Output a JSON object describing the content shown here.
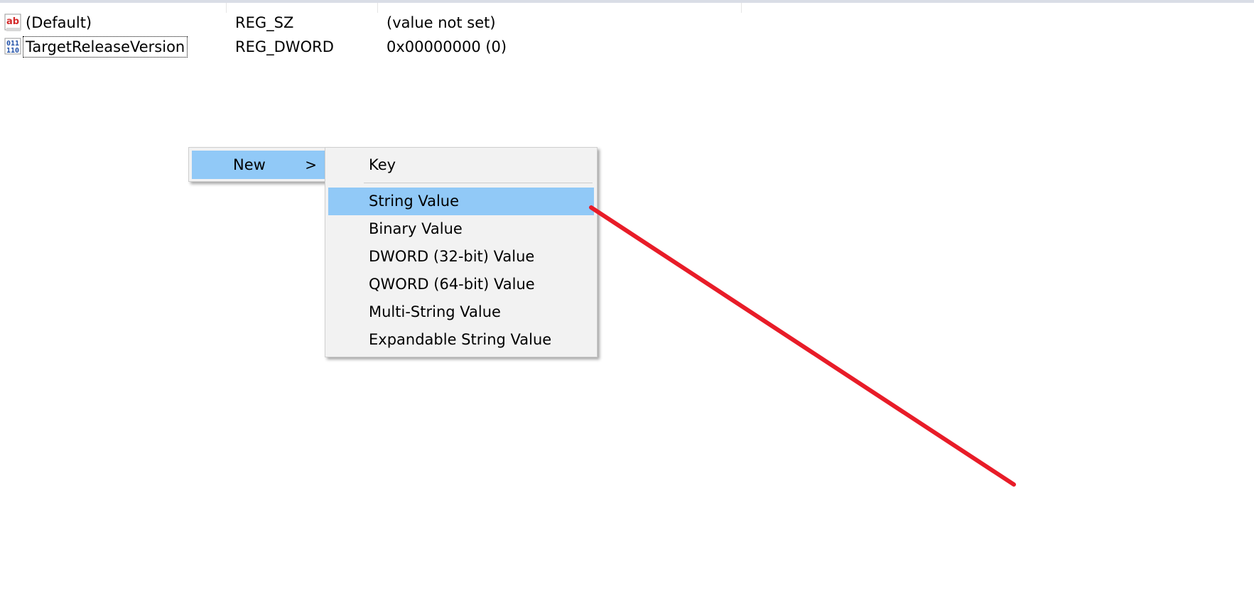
{
  "values": [
    {
      "name": "(Default)",
      "type": "REG_SZ",
      "data": "(value not set)",
      "icon": "string-value-icon"
    },
    {
      "name": "TargetReleaseVersion",
      "type": "REG_DWORD",
      "data": "0x00000000 (0)",
      "icon": "dword-value-icon"
    }
  ],
  "context_menu": {
    "new_label": "New",
    "submenu_arrow": ">"
  },
  "submenu": {
    "items": [
      {
        "label": "Key"
      },
      {
        "label": "String Value"
      },
      {
        "label": "Binary Value"
      },
      {
        "label": "DWORD (32-bit) Value"
      },
      {
        "label": "QWORD (64-bit) Value"
      },
      {
        "label": "Multi-String Value"
      },
      {
        "label": "Expandable String Value"
      }
    ],
    "highlighted": "String Value"
  },
  "annotation": {
    "color": "#e81c28"
  }
}
